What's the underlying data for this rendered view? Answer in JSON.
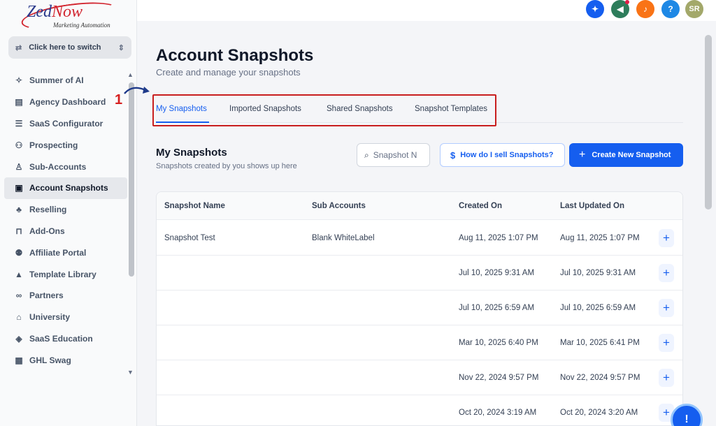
{
  "brand": {
    "logo_main": "Zed",
    "logo_accent": "Now",
    "logo_tagline": "Marketing Automation"
  },
  "switcher": {
    "label": "Click here to switch"
  },
  "sidebar": {
    "items": [
      {
        "label": "Summer of AI",
        "icon": "sparkle-icon"
      },
      {
        "label": "Agency Dashboard",
        "icon": "dashboard-icon"
      },
      {
        "label": "SaaS Configurator",
        "icon": "bar-chart-icon"
      },
      {
        "label": "Prospecting",
        "icon": "people-search-icon"
      },
      {
        "label": "Sub-Accounts",
        "icon": "user-icon"
      },
      {
        "label": "Account Snapshots",
        "icon": "snapshot-icon",
        "active": true
      },
      {
        "label": "Reselling",
        "icon": "network-icon"
      },
      {
        "label": "Add-Ons",
        "icon": "bag-icon"
      },
      {
        "label": "Affiliate Portal",
        "icon": "group-icon"
      },
      {
        "label": "Template Library",
        "icon": "shapes-icon"
      },
      {
        "label": "Partners",
        "icon": "handshake-icon"
      },
      {
        "label": "University",
        "icon": "graduation-cap-icon"
      },
      {
        "label": "SaaS Education",
        "icon": "cube-icon"
      },
      {
        "label": "GHL Swag",
        "icon": "store-icon"
      }
    ]
  },
  "annotation": {
    "step": "1"
  },
  "topbar": {
    "avatar_initials": "SR",
    "help_glyph": "?"
  },
  "page": {
    "title": "Account Snapshots",
    "subtitle": "Create and manage your snapshots"
  },
  "tabs": [
    {
      "label": "My Snapshots",
      "active": true
    },
    {
      "label": "Imported Snapshots"
    },
    {
      "label": "Shared Snapshots"
    },
    {
      "label": "Snapshot Templates"
    }
  ],
  "section": {
    "title": "My Snapshots",
    "subtitle": "Snapshots created by you shows up here"
  },
  "search": {
    "placeholder": "Snapshot Name"
  },
  "help_button": {
    "label": "How do I sell Snapshots?"
  },
  "create_button": {
    "label": "Create New Snapshot"
  },
  "table": {
    "columns": [
      "Snapshot Name",
      "Sub Accounts",
      "Created On",
      "Last Updated On"
    ],
    "rows": [
      {
        "name": "Snapshot Test",
        "sub_accounts": "Blank WhiteLabel",
        "created": "Aug 11, 2025 1:07 PM",
        "updated": "Aug 11, 2025 1:07 PM"
      },
      {
        "name": "",
        "sub_accounts": "",
        "created": "Jul 10, 2025 9:31 AM",
        "updated": "Jul 10, 2025 9:31 AM"
      },
      {
        "name": "",
        "sub_accounts": "",
        "created": "Jul 10, 2025 6:59 AM",
        "updated": "Jul 10, 2025 6:59 AM"
      },
      {
        "name": "",
        "sub_accounts": "",
        "created": "Mar 10, 2025 6:40 PM",
        "updated": "Mar 10, 2025 6:41 PM"
      },
      {
        "name": "",
        "sub_accounts": "",
        "created": "Nov 22, 2024 9:57 PM",
        "updated": "Nov 22, 2024 9:57 PM"
      },
      {
        "name": "",
        "sub_accounts": "",
        "created": "Oct 20, 2024 3:19 AM",
        "updated": "Oct 20, 2024 3:20 AM"
      }
    ]
  },
  "colors": {
    "primary": "#155eef",
    "annotation_red": "#c81e1e",
    "topbar_icons": [
      "#155eef",
      "#2e7d5b",
      "#f97316",
      "#1e88e5",
      "#a3a86a"
    ]
  }
}
